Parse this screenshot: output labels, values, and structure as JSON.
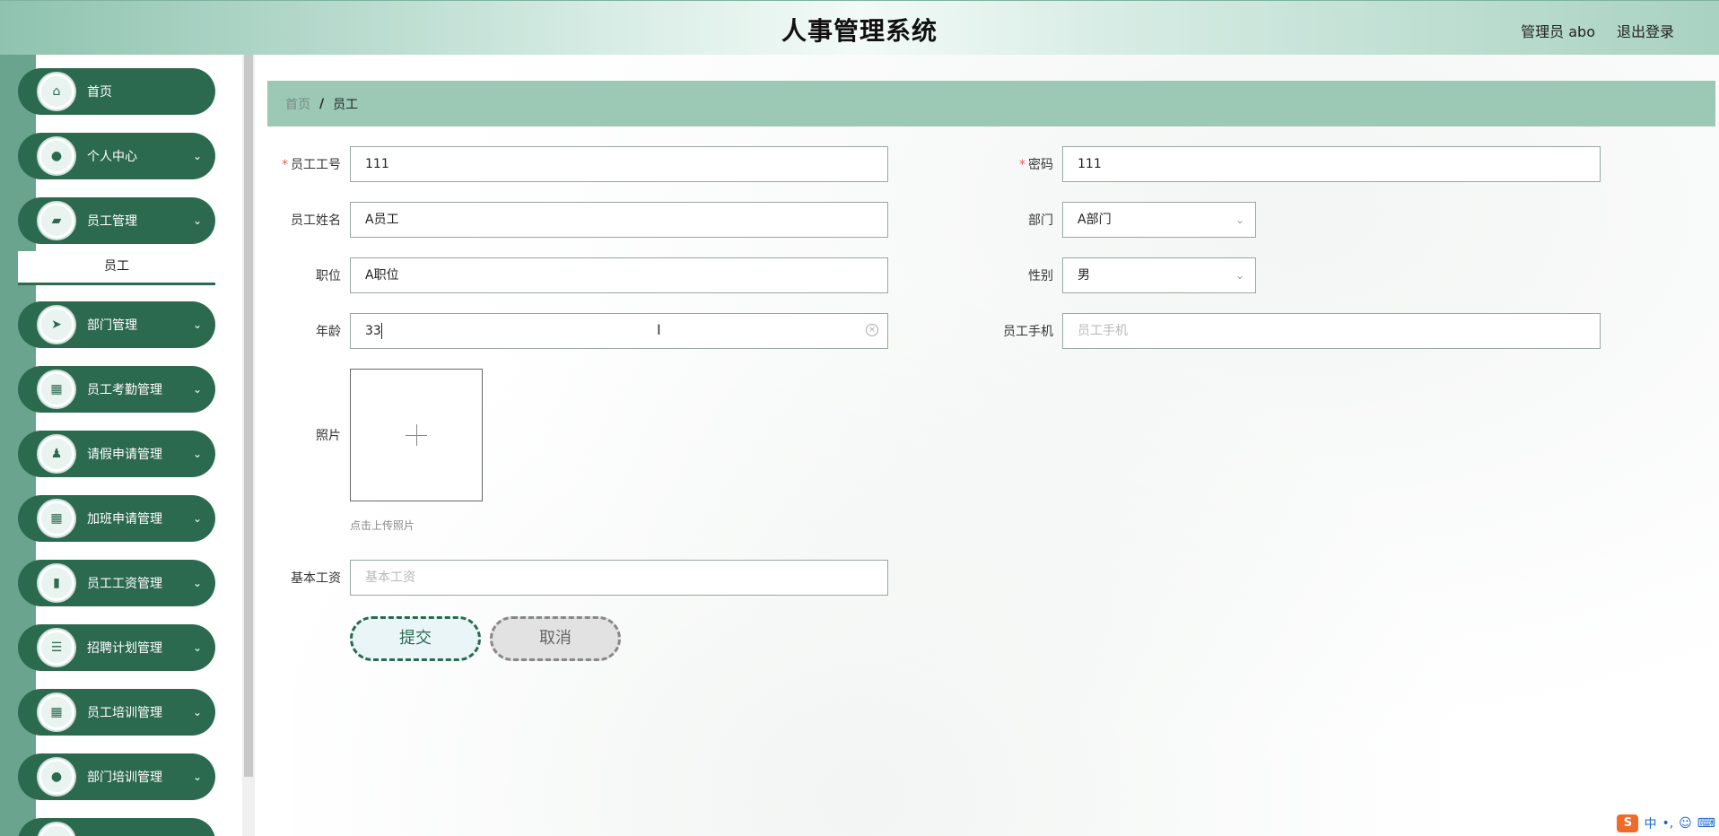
{
  "header": {
    "title": "人事管理系统",
    "user": "管理员 abo",
    "logout": "退出登录"
  },
  "sidebar": {
    "items": [
      {
        "label": "首页",
        "icon": "home-icon",
        "glyph": "⌂",
        "arrow": ""
      },
      {
        "label": "个人中心",
        "icon": "user-icon",
        "glyph": "●",
        "arrow": "⌄"
      },
      {
        "label": "员工管理",
        "icon": "briefcase-icon",
        "glyph": "▰",
        "arrow": "⌄"
      },
      {
        "label": "部门管理",
        "icon": "send-icon",
        "glyph": "➤",
        "arrow": "⌄"
      },
      {
        "label": "员工考勤管理",
        "icon": "grid-icon",
        "glyph": "▦",
        "arrow": "⌄"
      },
      {
        "label": "请假申请管理",
        "icon": "stamp-icon",
        "glyph": "♟",
        "arrow": "⌄"
      },
      {
        "label": "加班申请管理",
        "icon": "grid-icon",
        "glyph": "▦",
        "arrow": "⌄"
      },
      {
        "label": "员工工资管理",
        "icon": "bar-chart-icon",
        "glyph": "▮",
        "arrow": "⌄"
      },
      {
        "label": "招聘计划管理",
        "icon": "list-icon",
        "glyph": "☰",
        "arrow": "⌄"
      },
      {
        "label": "员工培训管理",
        "icon": "grid-icon",
        "glyph": "▦",
        "arrow": "⌄"
      },
      {
        "label": "部门培训管理",
        "icon": "user-icon",
        "glyph": "●",
        "arrow": "⌄"
      }
    ],
    "submenu": {
      "label": "员工"
    }
  },
  "breadcrumb": {
    "home": "首页",
    "separator": "/",
    "current": "员工"
  },
  "form": {
    "emp_no": {
      "label": "员工工号",
      "value": "111"
    },
    "password": {
      "label": "密码",
      "value": "111"
    },
    "emp_name": {
      "label": "员工姓名",
      "value": "A员工"
    },
    "department": {
      "label": "部门",
      "value": "A部门"
    },
    "position": {
      "label": "职位",
      "value": "A职位"
    },
    "gender": {
      "label": "性别",
      "value": "男"
    },
    "age": {
      "label": "年龄",
      "value": "33"
    },
    "phone": {
      "label": "员工手机",
      "placeholder": "员工手机"
    },
    "photo": {
      "label": "照片",
      "hint": "点击上传照片"
    },
    "salary": {
      "label": "基本工资",
      "placeholder": "基本工资"
    }
  },
  "buttons": {
    "submit": "提交",
    "cancel": "取消"
  },
  "ime": {
    "s": "S",
    "lang": "中",
    "punct": "•,",
    "emoji": "☺",
    "keyboard": "⌨"
  },
  "colors": {
    "primary": "#2c6a50",
    "breadcrumb_bg": "#9cc9b5",
    "required": "#e05a5a"
  }
}
